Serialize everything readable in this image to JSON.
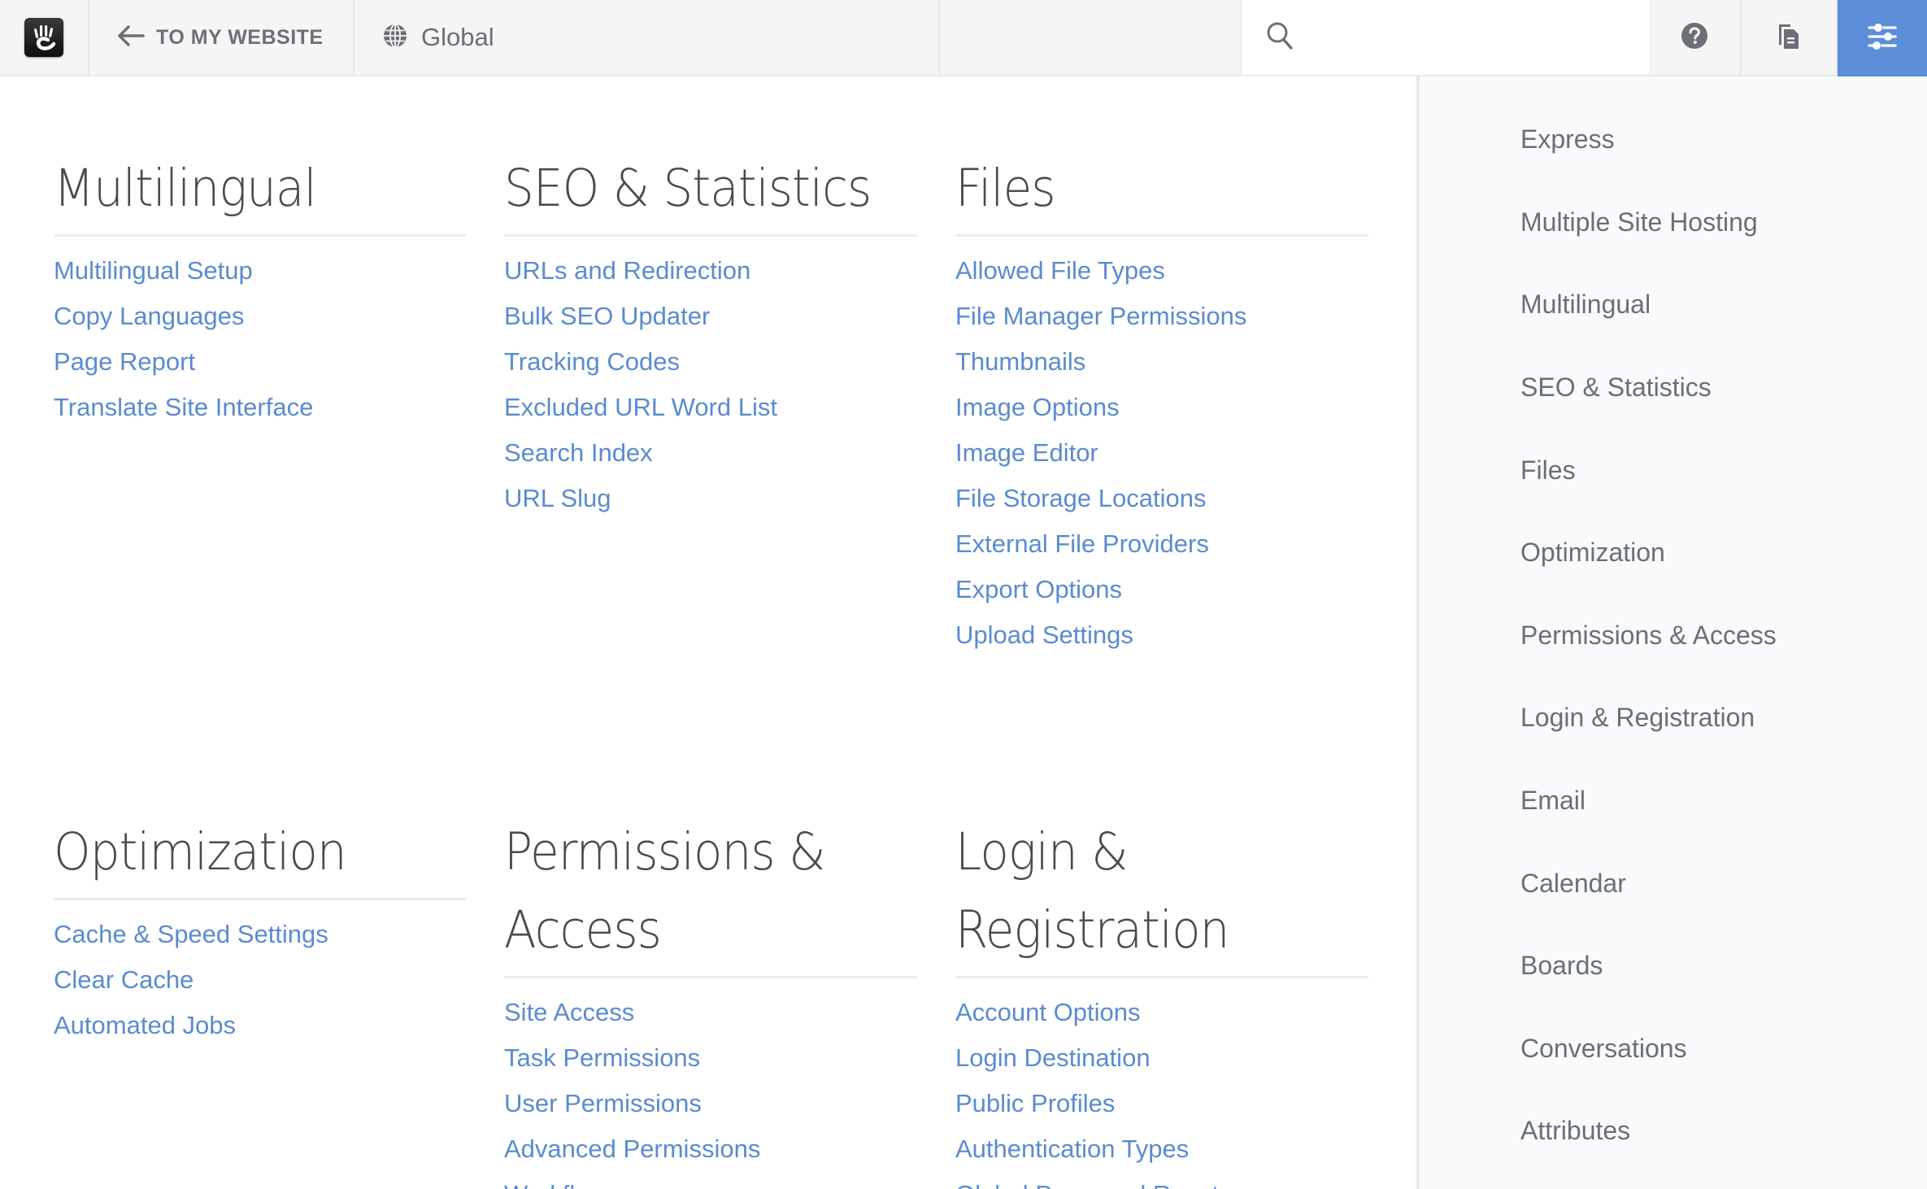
{
  "header": {
    "logo_alt": "concrete5 logo",
    "back_link_label": "TO MY WEBSITE",
    "site_selector_label": "Global",
    "search": {
      "value": "",
      "placeholder": ""
    },
    "icons": {
      "logo": "hand-logo-icon",
      "back": "arrow-left-icon",
      "globe": "globe-icon",
      "search": "search-icon",
      "help": "question-circle-icon",
      "pages": "copy-pages-icon",
      "settings": "sliders-icon"
    },
    "settings_active_color": "#5b8dd9"
  },
  "main": {
    "link_color": "#5a8bd0",
    "sections": [
      {
        "title": "Multilingual",
        "links": [
          "Multilingual Setup",
          "Copy Languages",
          "Page Report",
          "Translate Site Interface"
        ]
      },
      {
        "title": "SEO & Statistics",
        "links": [
          "URLs and Redirection",
          "Bulk SEO Updater",
          "Tracking Codes",
          "Excluded URL Word List",
          "Search Index",
          "URL Slug"
        ]
      },
      {
        "title": "Files",
        "links": [
          "Allowed File Types",
          "File Manager Permissions",
          "Thumbnails",
          "Image Options",
          "Image Editor",
          "File Storage Locations",
          "External File Providers",
          "Export Options",
          "Upload Settings"
        ]
      },
      {
        "title": "Optimization",
        "links": [
          "Cache & Speed Settings",
          "Clear Cache",
          "Automated Jobs"
        ]
      },
      {
        "title_lines": [
          "Permissions &",
          "Access"
        ],
        "links": [
          "Site Access",
          "Task Permissions",
          "User Permissions",
          "Advanced Permissions",
          "Workflows"
        ]
      },
      {
        "title_lines": [
          "Login &",
          "Registration"
        ],
        "links": [
          "Account Options",
          "Login Destination",
          "Public Profiles",
          "Authentication Types",
          "Global Password Reset"
        ]
      }
    ]
  },
  "sidebar": {
    "items": [
      "Express",
      "Multiple Site Hosting",
      "Multilingual",
      "SEO & Statistics",
      "Files",
      "Optimization",
      "Permissions & Access",
      "Login & Registration",
      "Email",
      "Calendar",
      "Boards",
      "Conversations",
      "Attributes"
    ]
  }
}
